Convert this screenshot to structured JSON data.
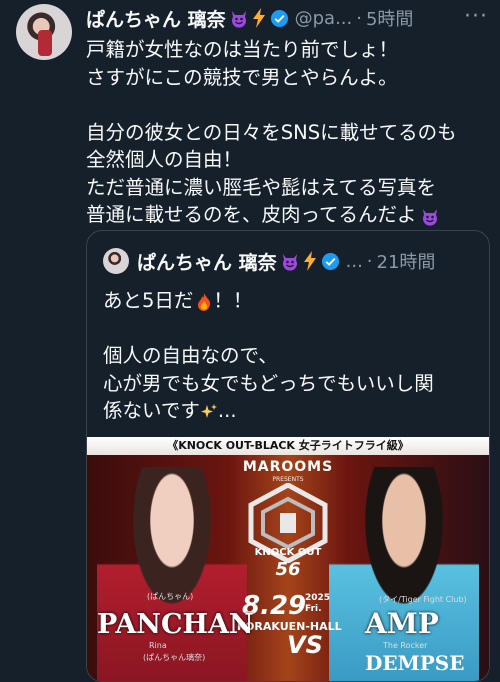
{
  "tweet": {
    "display_name": "ぱんちゃん 璃奈",
    "handle": "@pa...",
    "time": "5時間",
    "more": "···",
    "lines": [
      "戸籍が女性なのは当たり前でしょ！",
      "さすがにこの競技で男とやらんよ。",
      "",
      "自分の彼女との日々をSNSに載せてるのも",
      "全然個人の自由！",
      "ただ普通に濃い脛毛や髭はえてる写真を",
      "普通に載せるのを、皮肉ってるんだよ"
    ]
  },
  "quote": {
    "display_name": "ぱんちゃん 璃奈",
    "handle": "...",
    "time": "21時間",
    "line1": "あと5日だ",
    "line1_suffix": "！！",
    "line2": "個人の自由なので、",
    "line3": "心が男でも女でもどっちでもいいし関",
    "line4": "係ないです",
    "line4_suffix": "..."
  },
  "poster": {
    "banner": "《KNOCK OUT-BLACK 女子ライトフライ級》",
    "sponsor": "MAROOMS",
    "presents": "PRESENTS",
    "event": "KNOCK OUT",
    "event_number": "56",
    "date": "8.29",
    "year": "2025",
    "weekday": "Fri.",
    "venue": "KORAKUEN-HALL",
    "vs": "VS",
    "left_fighter": "PANCHAN",
    "left_kana": "(ぱんちゃん)",
    "left_sub1": "Rina",
    "left_sub2": "(ぱんちゃん璃奈)",
    "right_fighter": "AMP",
    "right_kana": "(タイ/Tiger Fight Club)",
    "right_sub1": "The Rocker",
    "right_sub2": "DEMPSE"
  },
  "colors": {
    "background": "#15202b",
    "text": "#f7f9f9",
    "muted": "#8b98a5",
    "verified": "#1d9bf0",
    "devil": "#9b4bd9",
    "bolt": "#ffac33"
  }
}
